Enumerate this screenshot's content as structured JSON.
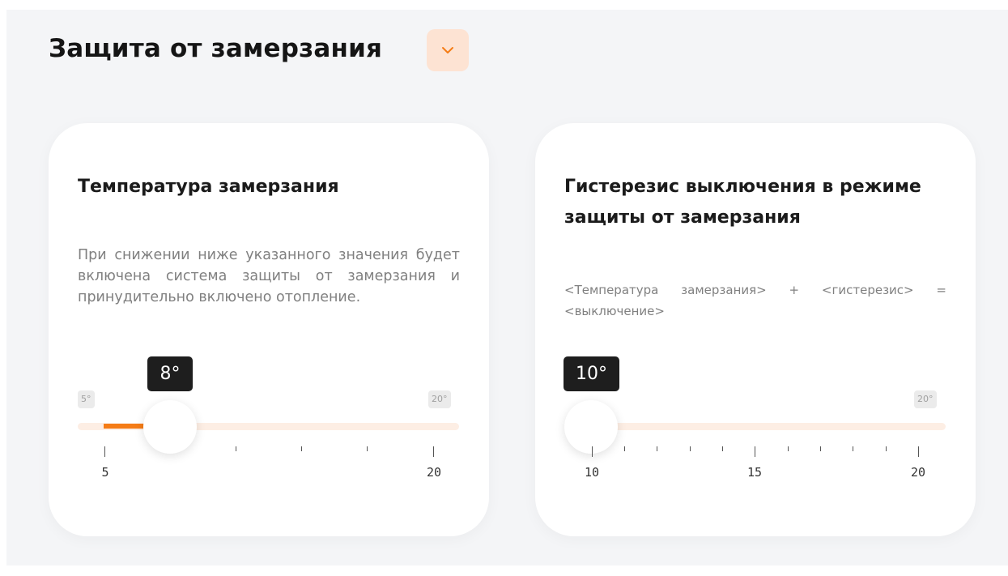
{
  "section": {
    "title": "Защита от замерзания",
    "toggle_icon": "chevron-down-icon",
    "accent_color": "#f57c16",
    "toggle_bg": "#fde3d3"
  },
  "cards": [
    {
      "title": "Температура замерзания",
      "description": "При снижении ниже указанного значения будет включена система защиты от замерзания и принудительно включено отопление.",
      "slider": {
        "value_label": "8°",
        "value": 8,
        "min": 5,
        "max": 20,
        "min_label": "5°",
        "max_label": "20°",
        "tick_labels": [
          "5",
          "20"
        ]
      }
    },
    {
      "title": "Гистерезис выключения в режиме защиты от замерзания",
      "description": "<Температура замерзания> + <гистерезис> = <выключение>",
      "slider": {
        "value_label": "10°",
        "value": 10,
        "min": 10,
        "max": 20,
        "max_label": "20°",
        "tick_labels": [
          "10",
          "15",
          "20"
        ]
      }
    }
  ]
}
